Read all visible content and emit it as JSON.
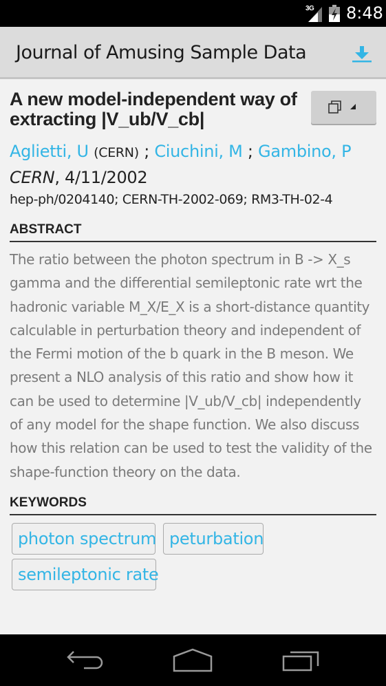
{
  "status_bar": {
    "network": "3G",
    "time": "8:48",
    "icons": [
      "signal-icon",
      "battery-charging-icon"
    ]
  },
  "action_bar": {
    "title": "Journal of Amusing Sample Data",
    "download_icon": "download-icon"
  },
  "article": {
    "title": "A new model-independent way of extracting |V_ub/V_cb|",
    "share_button_icon": "copy-icon",
    "authors": [
      {
        "name": "Aglietti, U",
        "affiliation": "(CERN)"
      },
      {
        "name": "Ciuchini, M",
        "affiliation": ""
      },
      {
        "name": "Gambino, P",
        "affiliation": ""
      }
    ],
    "separator": ";",
    "journal": "CERN",
    "date": ", 4/11/2002",
    "report_numbers": "hep-ph/0204140; CERN-TH-2002-069; RM3-TH-02-4"
  },
  "abstract": {
    "heading": "ABSTRACT",
    "lines": [
      "The ratio between the photon spectrum in B -> X_s",
      "gamma and the differential semileptonic rate wrt the",
      "hadronic variable M_X/E_X is a short-distance quantity",
      "calculable in perturbation theory and independent of",
      "the Fermi motion of the b quark in the B meson. We",
      "present a NLO analysis of this ratio and show how it",
      "can be used to determine |V_ub/V_cb| independently",
      "of any model for the shape function. We also discuss",
      "how this relation can be used to test the validity of the",
      "shape-function theory on the data."
    ]
  },
  "keywords": {
    "heading": "KEYWORDS",
    "items": [
      "photon spectrum",
      "peturbation",
      "semileptonic rate"
    ]
  },
  "nav_bar": {
    "buttons": [
      "back-icon",
      "home-icon",
      "recent-apps-icon"
    ]
  },
  "colors": {
    "accent": "#33b5e5",
    "action_bar": "#dcdcdc",
    "background": "#f2f2f2",
    "abstract_text": "#7a7a7a"
  }
}
